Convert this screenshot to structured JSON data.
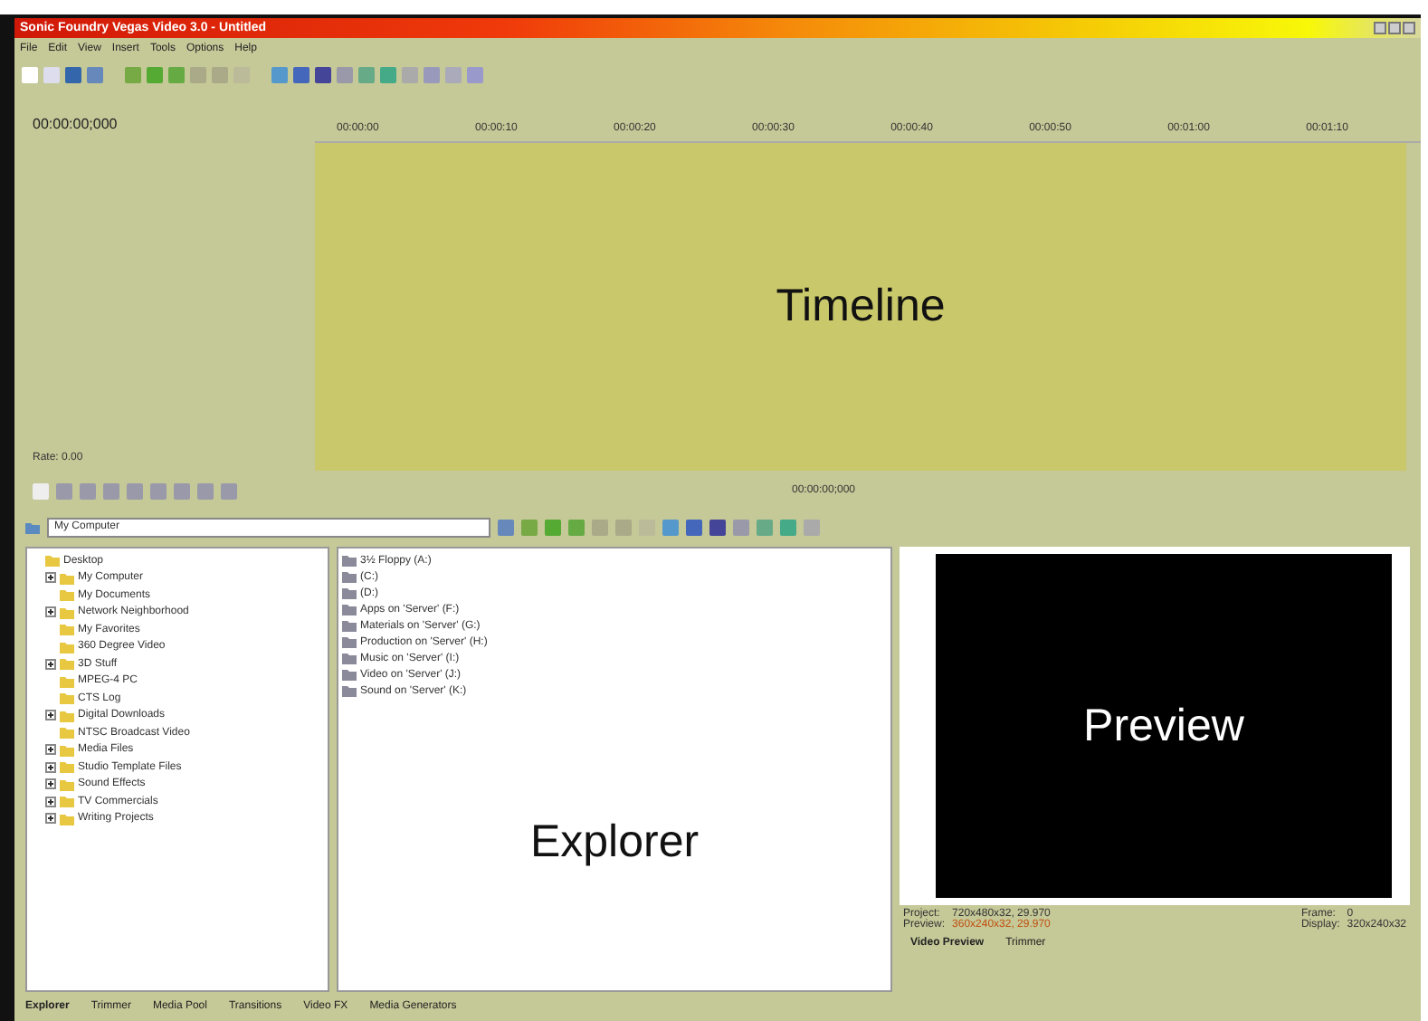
{
  "window": {
    "title": "Sonic Foundry Vegas Video 3.0 - Untitled"
  },
  "menu": [
    "File",
    "Edit",
    "View",
    "Insert",
    "Tools",
    "Options",
    "Help"
  ],
  "timeline": {
    "timecode": "00:00:00;000",
    "ruler": [
      "00:00:00",
      "00:00:10",
      "00:00:20",
      "00:00:30",
      "00:00:40",
      "00:00:50",
      "00:01:00",
      "00:01:10"
    ],
    "label": "Timeline",
    "rate": "Rate: 0.00",
    "cursor_time": "00:00:00;000"
  },
  "explorer": {
    "path": "My Computer",
    "label": "Explorer",
    "tree": [
      {
        "name": "Desktop",
        "expandable": false,
        "children": [
          {
            "name": "My Computer",
            "expandable": true
          },
          {
            "name": "My Documents",
            "expandable": false
          },
          {
            "name": "Network Neighborhood",
            "expandable": true
          },
          {
            "name": "My Favorites",
            "expandable": false
          },
          {
            "name": "360 Degree Video",
            "expandable": false
          },
          {
            "name": "3D Stuff",
            "expandable": true
          },
          {
            "name": "MPEG-4 PC",
            "expandable": false
          },
          {
            "name": "CTS Log",
            "expandable": false
          },
          {
            "name": "Digital Downloads",
            "expandable": true
          },
          {
            "name": "NTSC Broadcast Video",
            "expandable": false
          },
          {
            "name": "Media Files",
            "expandable": true
          },
          {
            "name": "Studio Template Files",
            "expandable": true
          },
          {
            "name": "Sound Effects",
            "expandable": true
          },
          {
            "name": "TV Commercials",
            "expandable": true
          },
          {
            "name": "Writing Projects",
            "expandable": true
          }
        ]
      }
    ],
    "items": [
      "3½ Floppy (A:)",
      "(C:)",
      "(D:)",
      "Apps on 'Server' (F:)",
      "Materials on 'Server' (G:)",
      "Production on 'Server' (H:)",
      "Music on 'Server' (I:)",
      "Video on 'Server' (J:)",
      "Sound on 'Server' (K:)"
    ]
  },
  "preview": {
    "label": "Preview",
    "info": [
      {
        "key": "Project:",
        "value": "720x480x32, 29.970",
        "accent": false
      },
      {
        "key": "Preview:",
        "value": "360x240x32, 29.970",
        "accent": true
      }
    ],
    "frame": [
      {
        "key": "Frame:",
        "value": "0"
      },
      {
        "key": "Display:",
        "value": "320x240x32"
      }
    ],
    "tabs": [
      {
        "label": "Video Preview",
        "selected": true
      },
      {
        "label": "Trimmer",
        "selected": false
      }
    ]
  },
  "dock_tabs": [
    {
      "label": "Explorer",
      "selected": true
    },
    {
      "label": "Trimmer",
      "selected": false
    },
    {
      "label": "Media Pool",
      "selected": false
    },
    {
      "label": "Transitions",
      "selected": false
    },
    {
      "label": "Video FX",
      "selected": false
    },
    {
      "label": "Media Generators",
      "selected": false
    }
  ]
}
